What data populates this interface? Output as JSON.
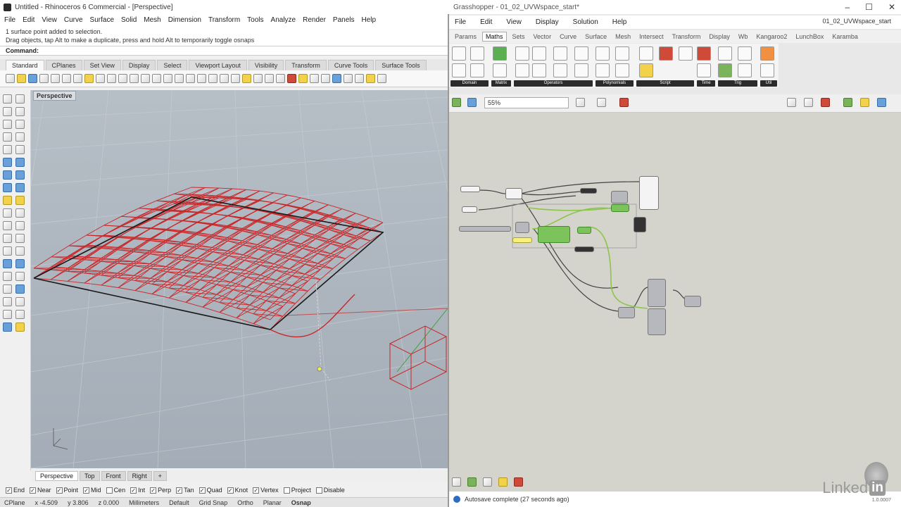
{
  "rhino": {
    "title": "Untitled - Rhinoceros 6 Commercial - [Perspective]",
    "menu": [
      "File",
      "Edit",
      "View",
      "Curve",
      "Surface",
      "Solid",
      "Mesh",
      "Dimension",
      "Transform",
      "Tools",
      "Analyze",
      "Render",
      "Panels",
      "Help"
    ],
    "history": [
      "1 surface point added to selection.",
      "Drag objects, tap Alt to make a duplicate, press and hold Alt to temporarily toggle osnaps"
    ],
    "command_label": "Command:",
    "tabs": [
      "Standard",
      "CPlanes",
      "Set View",
      "Display",
      "Select",
      "Viewport Layout",
      "Visibility",
      "Transform",
      "Curve Tools",
      "Surface Tools"
    ],
    "viewport_label": "Perspective",
    "viewport_tabs": [
      "Perspective",
      "Top",
      "Front",
      "Right"
    ],
    "osnaps": [
      {
        "label": "End",
        "checked": true
      },
      {
        "label": "Near",
        "checked": true
      },
      {
        "label": "Point",
        "checked": true
      },
      {
        "label": "Mid",
        "checked": true
      },
      {
        "label": "Cen",
        "checked": false
      },
      {
        "label": "Int",
        "checked": true
      },
      {
        "label": "Perp",
        "checked": true
      },
      {
        "label": "Tan",
        "checked": true
      },
      {
        "label": "Quad",
        "checked": true
      },
      {
        "label": "Knot",
        "checked": true
      },
      {
        "label": "Vertex",
        "checked": true
      },
      {
        "label": "Project",
        "checked": false
      },
      {
        "label": "Disable",
        "checked": false
      }
    ],
    "status": {
      "cplane": "CPlane",
      "x": "x -4.509",
      "y": "y 3.806",
      "z": "z 0.000",
      "units": "Millimeters",
      "layer": "Default",
      "grid_snap": "Grid Snap",
      "ortho": "Ortho",
      "planar": "Planar",
      "osnap": "Osnap"
    }
  },
  "grasshopper": {
    "title": "Grasshopper - 01_02_UVWspace_start*",
    "menu": [
      "File",
      "Edit",
      "View",
      "Display",
      "Solution",
      "Help"
    ],
    "project": "01_02_UVWspace_start",
    "categories": [
      "Params",
      "Maths",
      "Sets",
      "Vector",
      "Curve",
      "Surface",
      "Mesh",
      "Intersect",
      "Transform",
      "Display",
      "Wb",
      "Kangaroo2",
      "LunchBox",
      "Karamba"
    ],
    "active_category": "Maths",
    "panels": [
      "Domain",
      "Matrix",
      "Operators",
      "Polynomials",
      "Script",
      "Time",
      "Trig",
      "Util"
    ],
    "zoom": "55%",
    "status_text": "Autosave complete (27 seconds ago)",
    "version": "1.0.0007",
    "watermark": "Linked"
  },
  "colors": {
    "rhino_wire": "#c8282a",
    "gh_canvas": "#d4d3cc",
    "gh_green": "#7bc35a",
    "status_blue": "#2f6cc0"
  }
}
